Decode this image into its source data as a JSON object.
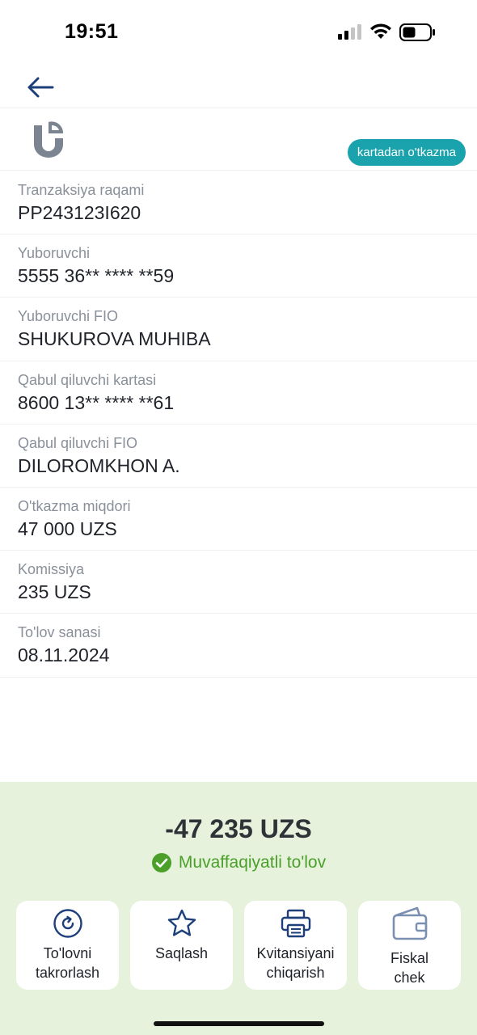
{
  "status_bar": {
    "time": "19:51"
  },
  "header": {
    "badge": "kartadan o'tkazma"
  },
  "details": [
    {
      "label": "Tranzaksiya raqami",
      "value": "PP243123I620"
    },
    {
      "label": "Yuboruvchi",
      "value": "5555 36** **** **59"
    },
    {
      "label": "Yuboruvchi FIO",
      "value": "SHUKUROVA MUHIBA"
    },
    {
      "label": "Qabul qiluvchi kartasi",
      "value": "8600 13** **** **61"
    },
    {
      "label": "Qabul qiluvchi FIO",
      "value": "DILOROMKHON A."
    },
    {
      "label": "O'tkazma miqdori",
      "value": "47 000 UZS"
    },
    {
      "label": "Komissiya",
      "value": "235 UZS"
    },
    {
      "label": "To'lov sanasi",
      "value": "08.11.2024"
    }
  ],
  "summary": {
    "amount": "-47 235 UZS",
    "status": "Muvaffaqiyatli to'lov",
    "status_color": "#4ba02a"
  },
  "actions": [
    {
      "line1": "To'lovni",
      "line2": "takrorlash",
      "icon": "repeat-icon"
    },
    {
      "line1": "Saqlash",
      "line2": "",
      "icon": "star-icon"
    },
    {
      "line1": "Kvitansiyani",
      "line2": "chiqarish",
      "icon": "printer-icon"
    },
    {
      "line1": "Fiskal",
      "line2": "chek",
      "icon": "wallet-icon"
    }
  ],
  "colors": {
    "accent": "#1aa3ad",
    "panel": "#e6f2dc",
    "nav_blue": "#1d3f7a"
  }
}
